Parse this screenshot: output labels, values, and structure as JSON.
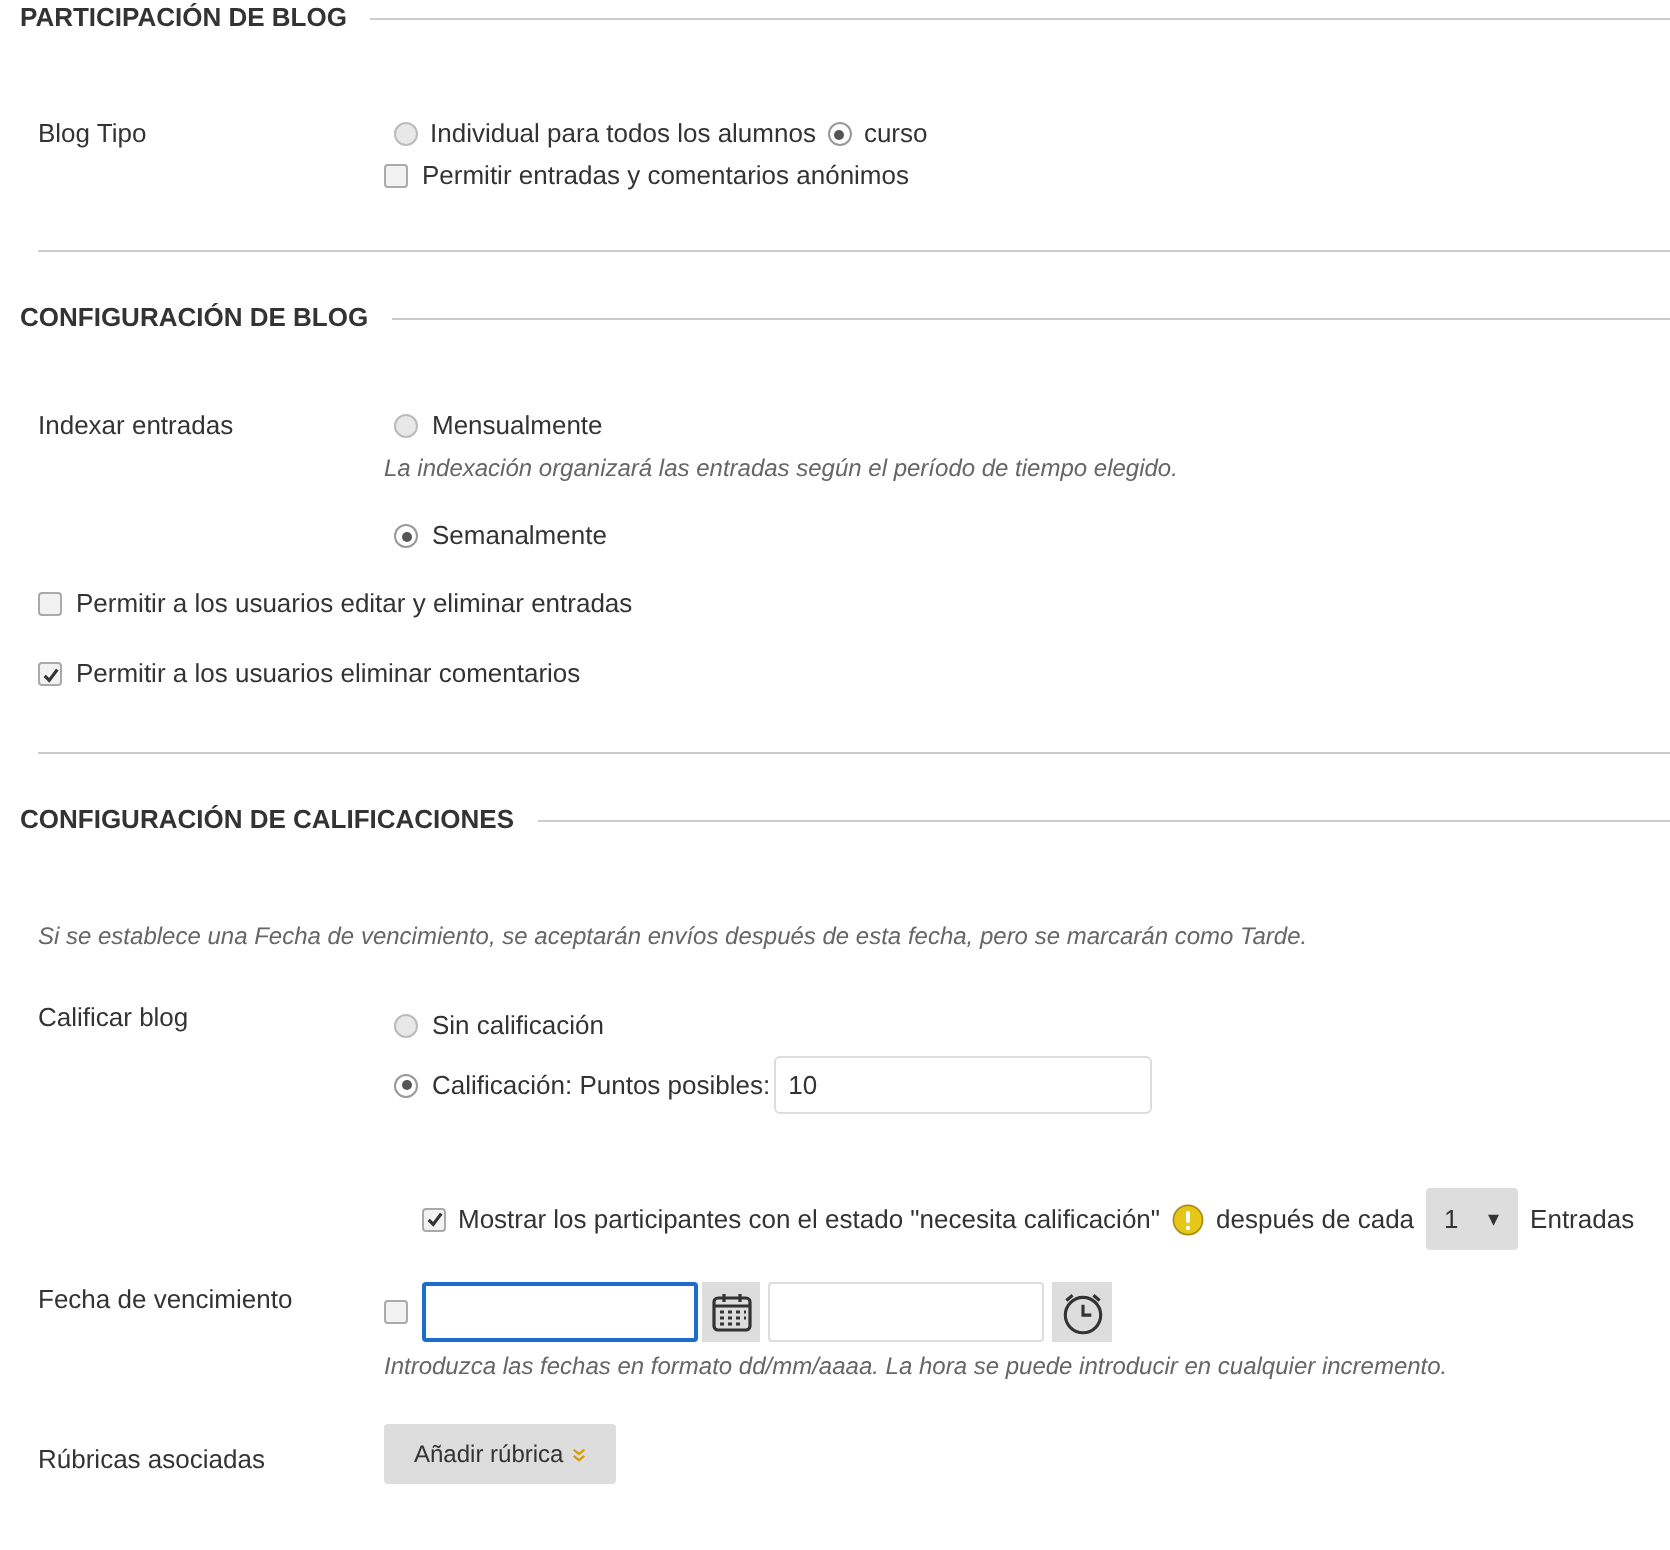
{
  "participation": {
    "heading": "PARTICIPACIÓN DE BLOG",
    "blog_type": {
      "label": "Blog Tipo",
      "options": [
        {
          "label": "Individual para todos los alumnos",
          "selected": false
        },
        {
          "label": "curso",
          "selected": true
        }
      ],
      "anonymous": {
        "label": "Permitir entradas y comentarios anónimos",
        "checked": false
      }
    }
  },
  "blog_config": {
    "heading": "CONFIGURACIÓN DE BLOG",
    "index": {
      "label": "Indexar entradas",
      "options": [
        {
          "label": "Mensualmente",
          "selected": false,
          "hint": "La indexación organizará las entradas según el período de tiempo elegido."
        },
        {
          "label": "Semanalmente",
          "selected": true
        }
      ]
    },
    "checkboxes": [
      {
        "label": "Permitir a los usuarios editar y eliminar entradas",
        "checked": false
      },
      {
        "label": "Permitir a los usuarios eliminar comentarios",
        "checked": true
      }
    ]
  },
  "grading": {
    "heading": "CONFIGURACIÓN DE CALIFICACIONES",
    "note": "Si se establece una Fecha de vencimiento, se aceptarán envíos después de esta fecha, pero se marcarán como Tarde.",
    "grade": {
      "label": "Calificar blog",
      "options": [
        {
          "label": "Sin calificación",
          "selected": false
        },
        {
          "label": "Calificación: Puntos posibles:",
          "selected": true,
          "value": "10"
        }
      ]
    },
    "needs_grading": {
      "checked": true,
      "label": "Mostrar los participantes con el estado \"necesita calificación\"",
      "after": "después de cada",
      "select_value": "1",
      "select_caret": "▾",
      "unit": "Entradas"
    },
    "due_date": {
      "label": "Fecha de vencimiento",
      "checked": false,
      "date_focused": true,
      "hint": "Introduzca las fechas en formato dd/mm/aaaa. La hora se puede introducir en cualquier incremento."
    },
    "rubrics": {
      "label": "Rúbricas asociadas",
      "button": "Añadir rúbrica"
    }
  }
}
